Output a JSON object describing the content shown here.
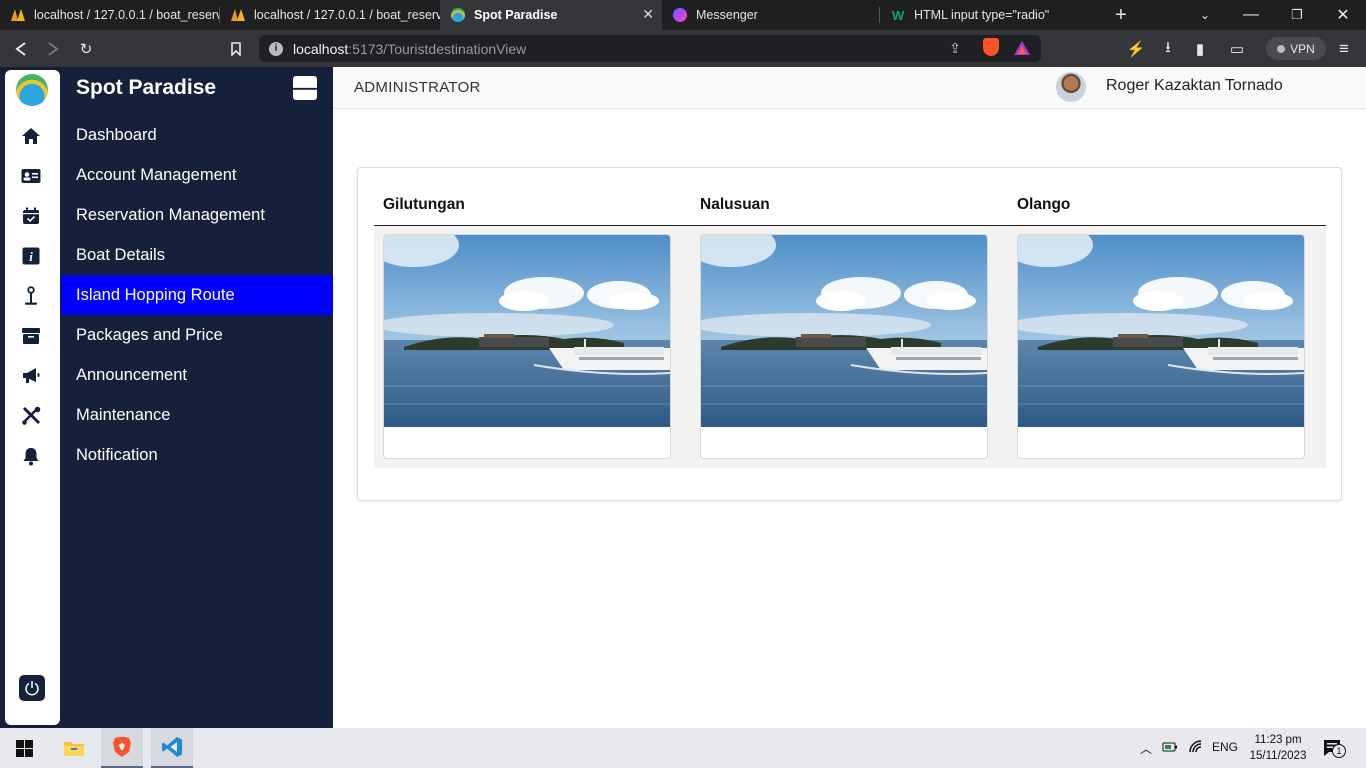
{
  "browser": {
    "tabs": [
      {
        "title": "localhost / 127.0.0.1 / boat_reserva",
        "icon": "phpmyadmin-icon",
        "active": false
      },
      {
        "title": "localhost / 127.0.0.1 / boat_reserva",
        "icon": "phpmyadmin-icon",
        "active": false
      },
      {
        "title": "Spot Paradise",
        "icon": "island-icon",
        "active": true
      },
      {
        "title": "Messenger",
        "icon": "messenger-icon",
        "active": false
      },
      {
        "title": "HTML input type=\"radio\"",
        "icon": "w3schools-icon",
        "active": false
      }
    ],
    "url_host": "localhost",
    "url_path": ":5173/TouristdestinationView",
    "vpn_label": "VPN"
  },
  "app": {
    "brand": "Spot Paradise",
    "menu": [
      {
        "label": "Dashboard",
        "icon": "home-icon",
        "active": false
      },
      {
        "label": "Account Management",
        "icon": "id-card-icon",
        "active": false
      },
      {
        "label": "Reservation Management",
        "icon": "calendar-check-icon",
        "active": false
      },
      {
        "label": "Boat Details",
        "icon": "info-icon",
        "active": false
      },
      {
        "label": "Island Hopping Route",
        "icon": "anchor-icon",
        "active": true
      },
      {
        "label": "Packages and Price",
        "icon": "box-icon",
        "active": false
      },
      {
        "label": "Announcement",
        "icon": "megaphone-icon",
        "active": false
      },
      {
        "label": "Maintenance",
        "icon": "tools-icon",
        "active": false
      },
      {
        "label": "Notification",
        "icon": "bell-icon",
        "active": false
      }
    ],
    "accent_color": "#0000ff",
    "sidebar_color": "#15203a"
  },
  "header": {
    "role": "ADMINISTRATOR",
    "username": "Roger Kazaktan Tornado"
  },
  "destinations": [
    {
      "name": "Gilutungan",
      "image": "boat-seascape-photo",
      "caption": ""
    },
    {
      "name": "Nalusuan",
      "image": "boat-seascape-photo",
      "caption": ""
    },
    {
      "name": "Olango",
      "image": "boat-seascape-photo",
      "caption": ""
    }
  ],
  "taskbar": {
    "apps": [
      "windows-start-icon",
      "file-explorer-icon",
      "brave-icon",
      "vscode-icon"
    ],
    "language": "ENG",
    "time": "11:23 pm",
    "date": "15/11/2023",
    "notification_count": "1"
  }
}
